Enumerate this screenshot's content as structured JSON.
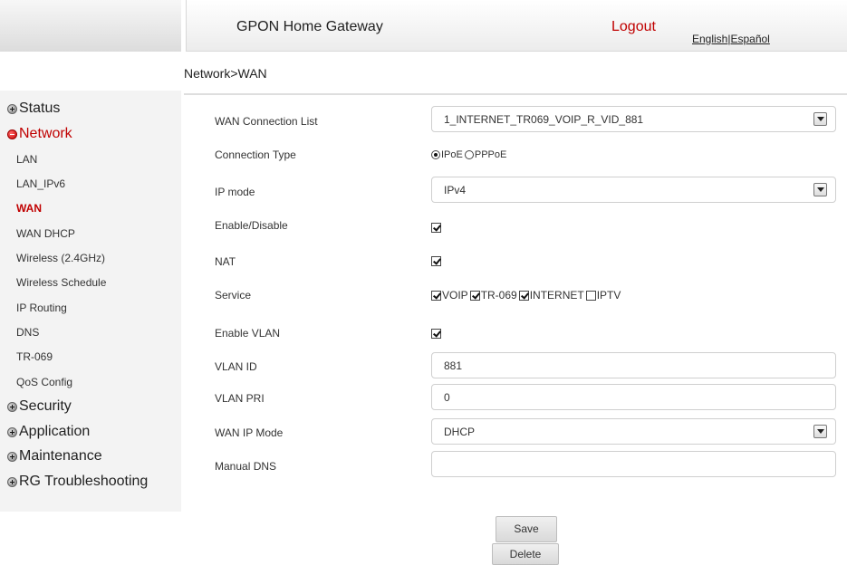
{
  "header": {
    "title": "GPON Home Gateway",
    "logout": "Logout",
    "lang_english": "English",
    "lang_separator": "|",
    "lang_spanish": "Español"
  },
  "breadcrumb": "Network>WAN",
  "sidebar": {
    "groups": {
      "status": "Status",
      "network": "Network",
      "security": "Security",
      "application": "Application",
      "maintenance": "Maintenance",
      "rg_troubleshooting": "RG Troubleshooting"
    },
    "network_items": [
      "LAN",
      "LAN_IPv6",
      "WAN",
      "WAN DHCP",
      "Wireless (2.4GHz)",
      "Wireless Schedule",
      "IP Routing",
      "DNS",
      "TR-069",
      "QoS Config"
    ],
    "active_item": "WAN",
    "active_color": "#c00000"
  },
  "form": {
    "wan_connection_list": {
      "label": "WAN Connection List",
      "value": "1_INTERNET_TR069_VOIP_R_VID_881"
    },
    "connection_type": {
      "label": "Connection Type",
      "options": [
        "IPoE",
        "PPPoE"
      ],
      "selected": "IPoE"
    },
    "ip_mode": {
      "label": "IP mode",
      "value": "IPv4"
    },
    "enable_disable": {
      "label": "Enable/Disable",
      "checked": true
    },
    "nat": {
      "label": "NAT",
      "checked": true
    },
    "service": {
      "label": "Service",
      "options": [
        {
          "name": "VOIP",
          "checked": true
        },
        {
          "name": "TR-069",
          "checked": true
        },
        {
          "name": "INTERNET",
          "checked": true
        },
        {
          "name": "IPTV",
          "checked": false
        }
      ]
    },
    "enable_vlan": {
      "label": "Enable VLAN",
      "checked": true
    },
    "vlan_id": {
      "label": "VLAN ID",
      "value": "881"
    },
    "vlan_pri": {
      "label": "VLAN PRI",
      "value": "0"
    },
    "wan_ip_mode": {
      "label": "WAN IP Mode",
      "value": "DHCP"
    },
    "manual_dns": {
      "label": "Manual DNS",
      "value": ""
    }
  },
  "buttons": {
    "save": "Save",
    "delete": "Delete"
  }
}
